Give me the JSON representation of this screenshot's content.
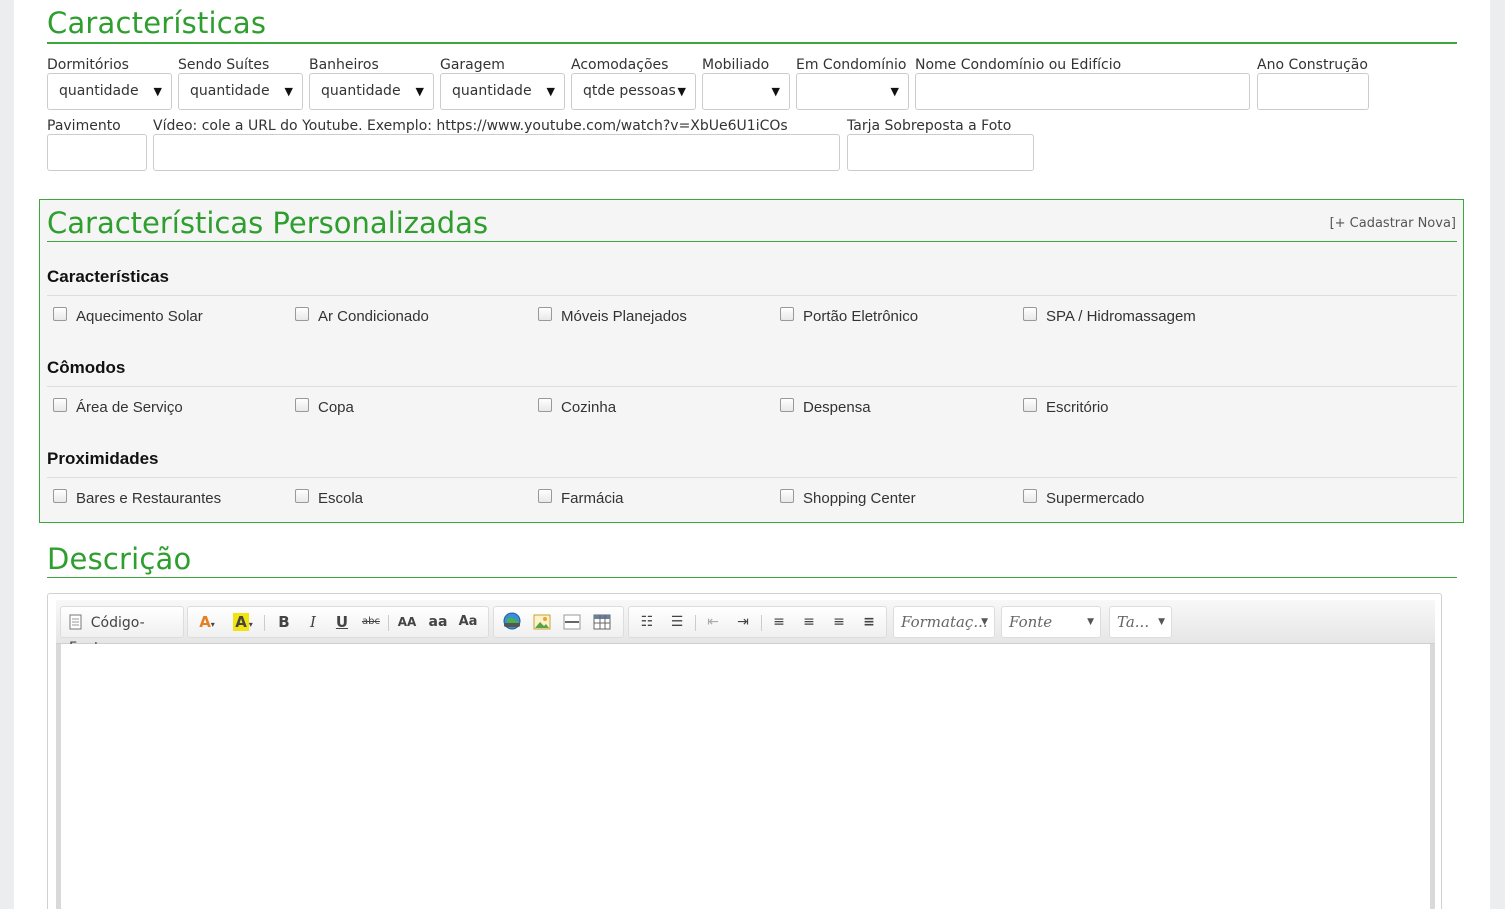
{
  "caracteristicas": {
    "title": "Características",
    "fields": {
      "dormitorios": {
        "label": "Dormitórios",
        "value": "quantidade"
      },
      "suites": {
        "label": "Sendo Suítes",
        "value": "quantidade"
      },
      "banheiros": {
        "label": "Banheiros",
        "value": "quantidade"
      },
      "garagem": {
        "label": "Garagem",
        "value": "quantidade"
      },
      "acomodacoes": {
        "label": "Acomodações",
        "value": "qtde pessoas"
      },
      "mobiliado": {
        "label": "Mobiliado",
        "value": ""
      },
      "condominio": {
        "label": "Em Condomínio",
        "value": ""
      },
      "nome_condominio": {
        "label": "Nome Condomínio ou Edifício",
        "value": ""
      },
      "ano": {
        "label": "Ano Construção",
        "value": ""
      },
      "pavimento": {
        "label": "Pavimento",
        "value": ""
      },
      "video": {
        "label": "Vídeo: cole a URL do Youtube. Exemplo: https://www.youtube.com/watch?v=XbUe6U1iCOs",
        "value": ""
      },
      "tarja": {
        "label": "Tarja Sobreposta a Foto",
        "value": ""
      }
    }
  },
  "personalizadas": {
    "title": "Características Personalizadas",
    "add_link": "[+ Cadastrar Nova]",
    "groups": [
      {
        "title": "Características",
        "items": [
          "Aquecimento Solar",
          "Ar Condicionado",
          "Móveis Planejados",
          "Portão Eletrônico",
          "SPA / Hidromassagem"
        ]
      },
      {
        "title": "Cômodos",
        "items": [
          "Área de Serviço",
          "Copa",
          "Cozinha",
          "Despensa",
          "Escritório"
        ]
      },
      {
        "title": "Proximidades",
        "items": [
          "Bares e Restaurantes",
          "Escola",
          "Farmácia",
          "Shopping Center",
          "Supermercado"
        ]
      }
    ]
  },
  "descricao": {
    "title": "Descrição",
    "toolbar": {
      "source_label": "Código-Fonte",
      "format_combo": "Formataç...",
      "font_combo": "Fonte",
      "size_combo": "Ta..."
    }
  }
}
